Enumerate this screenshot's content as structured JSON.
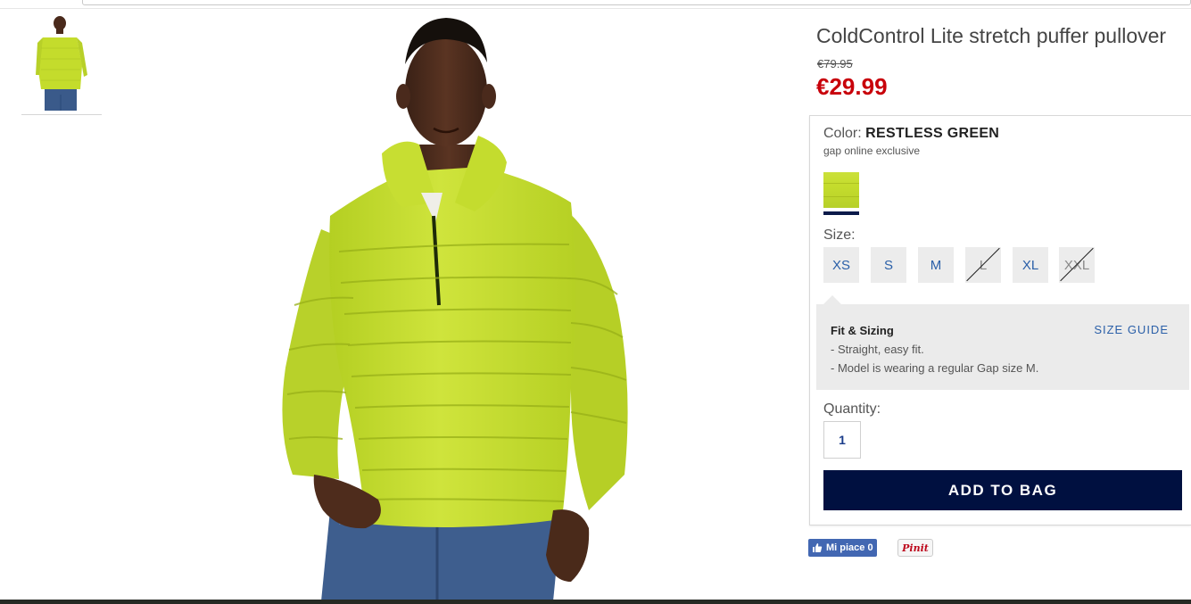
{
  "product": {
    "title": "ColdControl Lite stretch puffer pullover",
    "original_price": "€79.95",
    "sale_price": "€29.99"
  },
  "color": {
    "label": "Color:",
    "value": "RESTLESS GREEN",
    "note": "gap online exclusive",
    "swatch_color": "#c4dc2c",
    "selected_underline_color": "#0b1a4a"
  },
  "size": {
    "label": "Size:",
    "options": [
      {
        "label": "XS",
        "available": true
      },
      {
        "label": "S",
        "available": true
      },
      {
        "label": "M",
        "available": true
      },
      {
        "label": "L",
        "available": false
      },
      {
        "label": "XL",
        "available": true
      },
      {
        "label": "XXL",
        "available": false
      }
    ]
  },
  "fit": {
    "title": "Fit & Sizing",
    "size_guide_label": "SIZE GUIDE",
    "items": [
      "-  Straight, easy fit.",
      "-  Model is wearing a regular Gap size M."
    ]
  },
  "quantity": {
    "label": "Quantity:",
    "value": "1"
  },
  "add_to_bag_label": "ADD TO BAG",
  "social": {
    "like_label": "Mi piace 0",
    "pin_label": "Pinit"
  },
  "colors": {
    "price_red": "#c8000a",
    "navy": "#001040",
    "link_blue": "#2a5fa8",
    "jacket_green": "#c4dc2c"
  }
}
